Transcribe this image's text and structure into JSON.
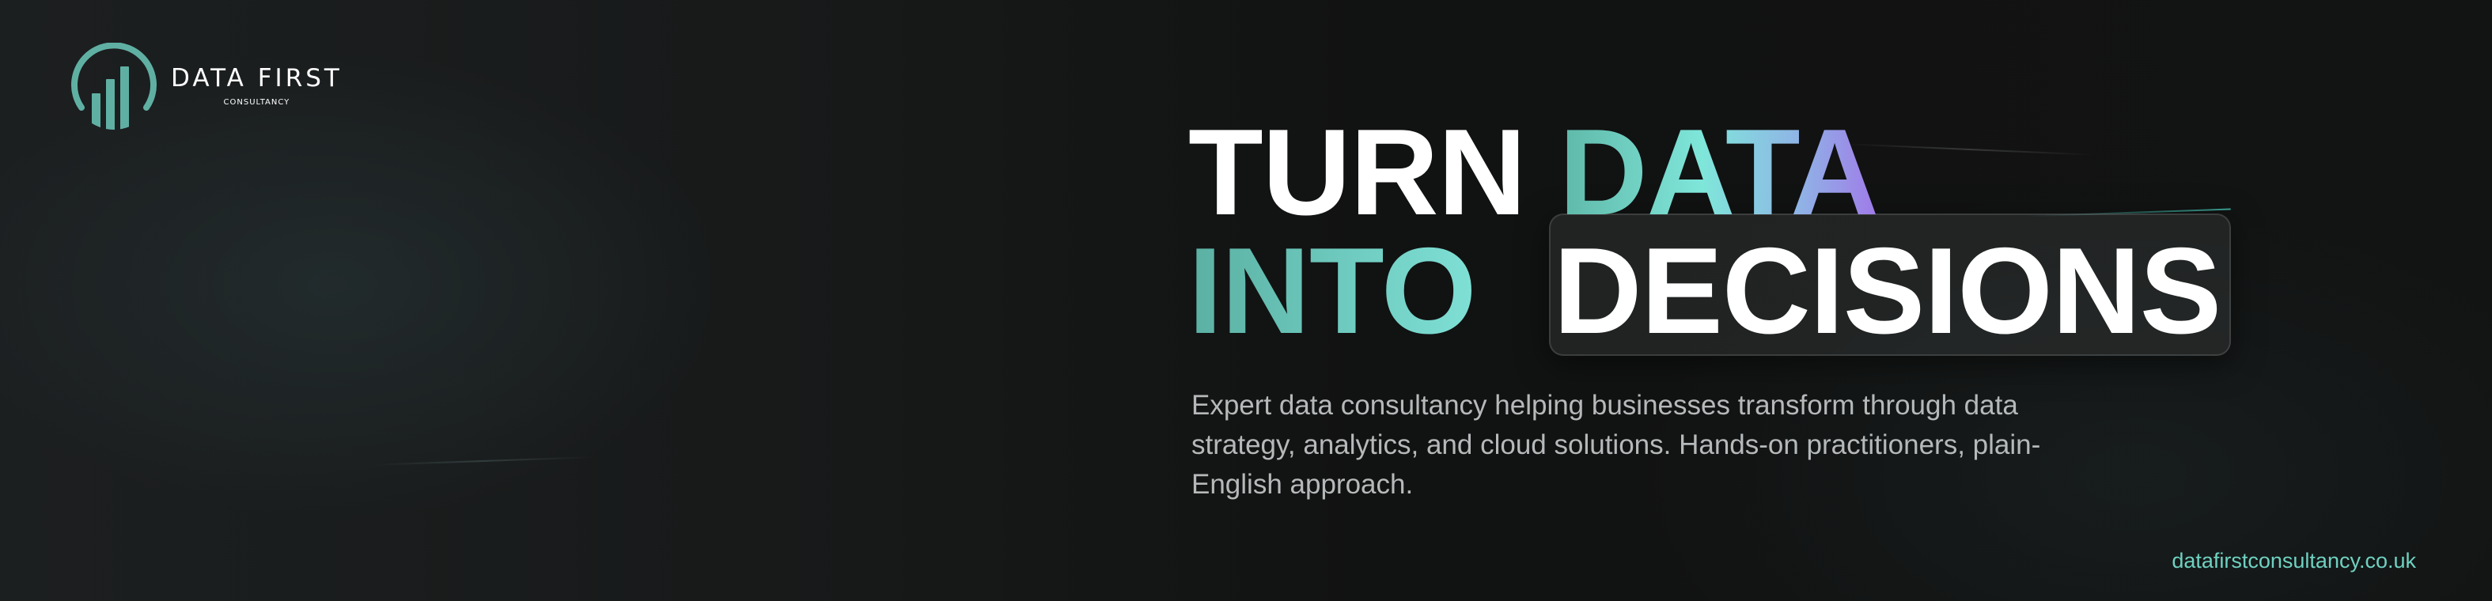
{
  "brand": {
    "name": "DATA FIRST",
    "tagline": "CONSULTANCY",
    "accent_color": "#5fb0a3",
    "logo_icon": "bar-chart-circle-icon"
  },
  "headline": {
    "line1_word1": "TURN",
    "line1_word2": "DATA",
    "line2_word1": "INTO",
    "line2_word2": "DECISIONS"
  },
  "description": "Expert data consultancy helping businesses transform through data strategy, analytics, and cloud solutions. Hands-on practitioners, plain-English approach.",
  "website": "datafirstconsultancy.co.uk",
  "colors": {
    "background": "#141616",
    "headline_white": "#ffffff",
    "teal": "#6fd1c1",
    "purple": "#a07ae8",
    "body_text": "#b6b9ba"
  }
}
